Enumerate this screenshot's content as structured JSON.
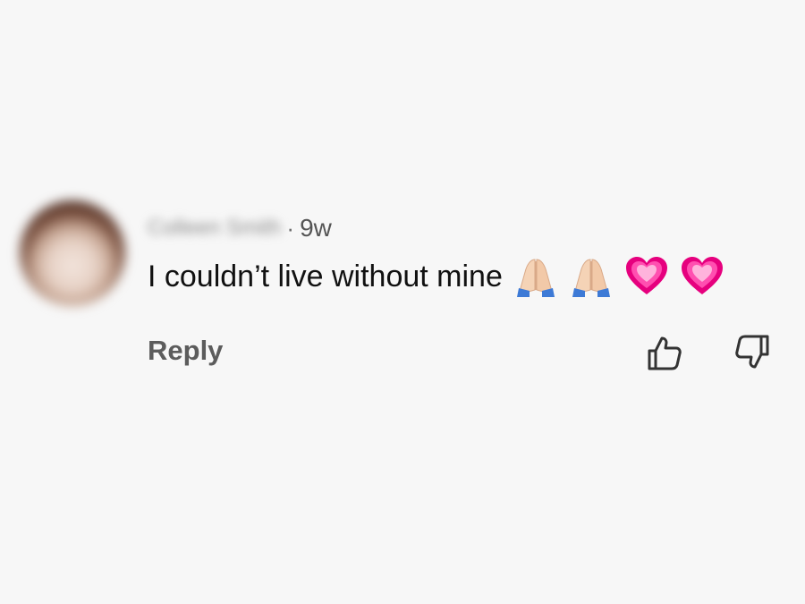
{
  "comment": {
    "username": "Colleen Smith",
    "separator": "·",
    "age": "9w",
    "text": "I couldn’t live without mine",
    "emojis": [
      "folded-hands",
      "folded-hands",
      "growing-heart",
      "growing-heart"
    ],
    "reply_label": "Reply"
  },
  "icons": {
    "like": "thumbs-up-icon",
    "dislike": "thumbs-down-icon"
  },
  "colors": {
    "background": "#f7f7f7",
    "text": "#111111",
    "muted": "#5c5c5c",
    "heart": "#e6007e"
  }
}
